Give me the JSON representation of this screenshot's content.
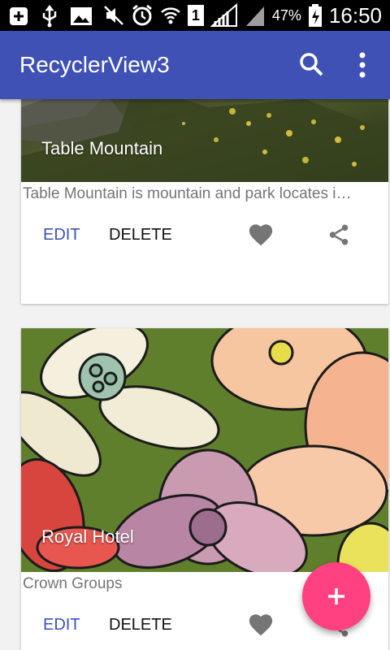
{
  "status_bar": {
    "battery_percent": "47%",
    "time": "16:50",
    "signal_label": "1"
  },
  "app_bar": {
    "title": "RecyclerView3",
    "color": "#3f51b5"
  },
  "cards": [
    {
      "title": "Table Mountain",
      "description": "Table Mountain is mountain and park locates i…",
      "edit_label": "EDIT",
      "delete_label": "DELETE"
    },
    {
      "title": "Royal Hotel",
      "description": "Crown Groups",
      "edit_label": "EDIT",
      "delete_label": "DELETE"
    }
  ],
  "fab": {
    "icon": "plus-icon",
    "color": "#ff4081"
  }
}
